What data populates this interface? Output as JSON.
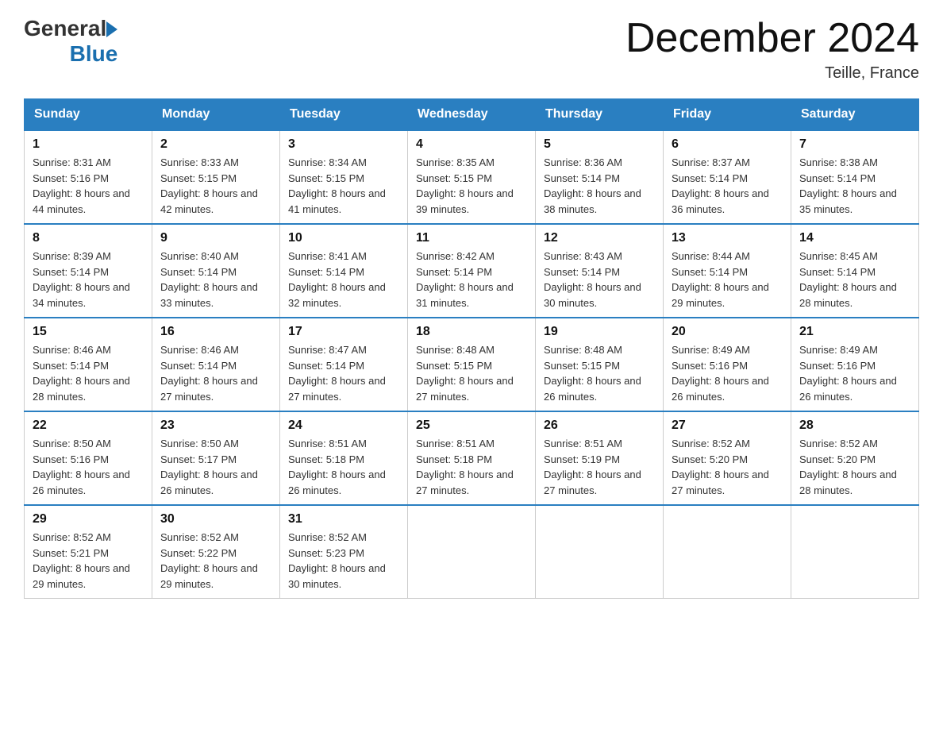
{
  "header": {
    "logo_general": "General",
    "logo_blue": "Blue",
    "month_title": "December 2024",
    "location": "Teille, France"
  },
  "days_of_week": [
    "Sunday",
    "Monday",
    "Tuesday",
    "Wednesday",
    "Thursday",
    "Friday",
    "Saturday"
  ],
  "weeks": [
    [
      {
        "day": "1",
        "sunrise": "8:31 AM",
        "sunset": "5:16 PM",
        "daylight": "8 hours and 44 minutes."
      },
      {
        "day": "2",
        "sunrise": "8:33 AM",
        "sunset": "5:15 PM",
        "daylight": "8 hours and 42 minutes."
      },
      {
        "day": "3",
        "sunrise": "8:34 AM",
        "sunset": "5:15 PM",
        "daylight": "8 hours and 41 minutes."
      },
      {
        "day": "4",
        "sunrise": "8:35 AM",
        "sunset": "5:15 PM",
        "daylight": "8 hours and 39 minutes."
      },
      {
        "day": "5",
        "sunrise": "8:36 AM",
        "sunset": "5:14 PM",
        "daylight": "8 hours and 38 minutes."
      },
      {
        "day": "6",
        "sunrise": "8:37 AM",
        "sunset": "5:14 PM",
        "daylight": "8 hours and 36 minutes."
      },
      {
        "day": "7",
        "sunrise": "8:38 AM",
        "sunset": "5:14 PM",
        "daylight": "8 hours and 35 minutes."
      }
    ],
    [
      {
        "day": "8",
        "sunrise": "8:39 AM",
        "sunset": "5:14 PM",
        "daylight": "8 hours and 34 minutes."
      },
      {
        "day": "9",
        "sunrise": "8:40 AM",
        "sunset": "5:14 PM",
        "daylight": "8 hours and 33 minutes."
      },
      {
        "day": "10",
        "sunrise": "8:41 AM",
        "sunset": "5:14 PM",
        "daylight": "8 hours and 32 minutes."
      },
      {
        "day": "11",
        "sunrise": "8:42 AM",
        "sunset": "5:14 PM",
        "daylight": "8 hours and 31 minutes."
      },
      {
        "day": "12",
        "sunrise": "8:43 AM",
        "sunset": "5:14 PM",
        "daylight": "8 hours and 30 minutes."
      },
      {
        "day": "13",
        "sunrise": "8:44 AM",
        "sunset": "5:14 PM",
        "daylight": "8 hours and 29 minutes."
      },
      {
        "day": "14",
        "sunrise": "8:45 AM",
        "sunset": "5:14 PM",
        "daylight": "8 hours and 28 minutes."
      }
    ],
    [
      {
        "day": "15",
        "sunrise": "8:46 AM",
        "sunset": "5:14 PM",
        "daylight": "8 hours and 28 minutes."
      },
      {
        "day": "16",
        "sunrise": "8:46 AM",
        "sunset": "5:14 PM",
        "daylight": "8 hours and 27 minutes."
      },
      {
        "day": "17",
        "sunrise": "8:47 AM",
        "sunset": "5:14 PM",
        "daylight": "8 hours and 27 minutes."
      },
      {
        "day": "18",
        "sunrise": "8:48 AM",
        "sunset": "5:15 PM",
        "daylight": "8 hours and 27 minutes."
      },
      {
        "day": "19",
        "sunrise": "8:48 AM",
        "sunset": "5:15 PM",
        "daylight": "8 hours and 26 minutes."
      },
      {
        "day": "20",
        "sunrise": "8:49 AM",
        "sunset": "5:16 PM",
        "daylight": "8 hours and 26 minutes."
      },
      {
        "day": "21",
        "sunrise": "8:49 AM",
        "sunset": "5:16 PM",
        "daylight": "8 hours and 26 minutes."
      }
    ],
    [
      {
        "day": "22",
        "sunrise": "8:50 AM",
        "sunset": "5:16 PM",
        "daylight": "8 hours and 26 minutes."
      },
      {
        "day": "23",
        "sunrise": "8:50 AM",
        "sunset": "5:17 PM",
        "daylight": "8 hours and 26 minutes."
      },
      {
        "day": "24",
        "sunrise": "8:51 AM",
        "sunset": "5:18 PM",
        "daylight": "8 hours and 26 minutes."
      },
      {
        "day": "25",
        "sunrise": "8:51 AM",
        "sunset": "5:18 PM",
        "daylight": "8 hours and 27 minutes."
      },
      {
        "day": "26",
        "sunrise": "8:51 AM",
        "sunset": "5:19 PM",
        "daylight": "8 hours and 27 minutes."
      },
      {
        "day": "27",
        "sunrise": "8:52 AM",
        "sunset": "5:20 PM",
        "daylight": "8 hours and 27 minutes."
      },
      {
        "day": "28",
        "sunrise": "8:52 AM",
        "sunset": "5:20 PM",
        "daylight": "8 hours and 28 minutes."
      }
    ],
    [
      {
        "day": "29",
        "sunrise": "8:52 AM",
        "sunset": "5:21 PM",
        "daylight": "8 hours and 29 minutes."
      },
      {
        "day": "30",
        "sunrise": "8:52 AM",
        "sunset": "5:22 PM",
        "daylight": "8 hours and 29 minutes."
      },
      {
        "day": "31",
        "sunrise": "8:52 AM",
        "sunset": "5:23 PM",
        "daylight": "8 hours and 30 minutes."
      },
      null,
      null,
      null,
      null
    ]
  ],
  "labels": {
    "sunrise_prefix": "Sunrise: ",
    "sunset_prefix": "Sunset: ",
    "daylight_prefix": "Daylight: "
  }
}
